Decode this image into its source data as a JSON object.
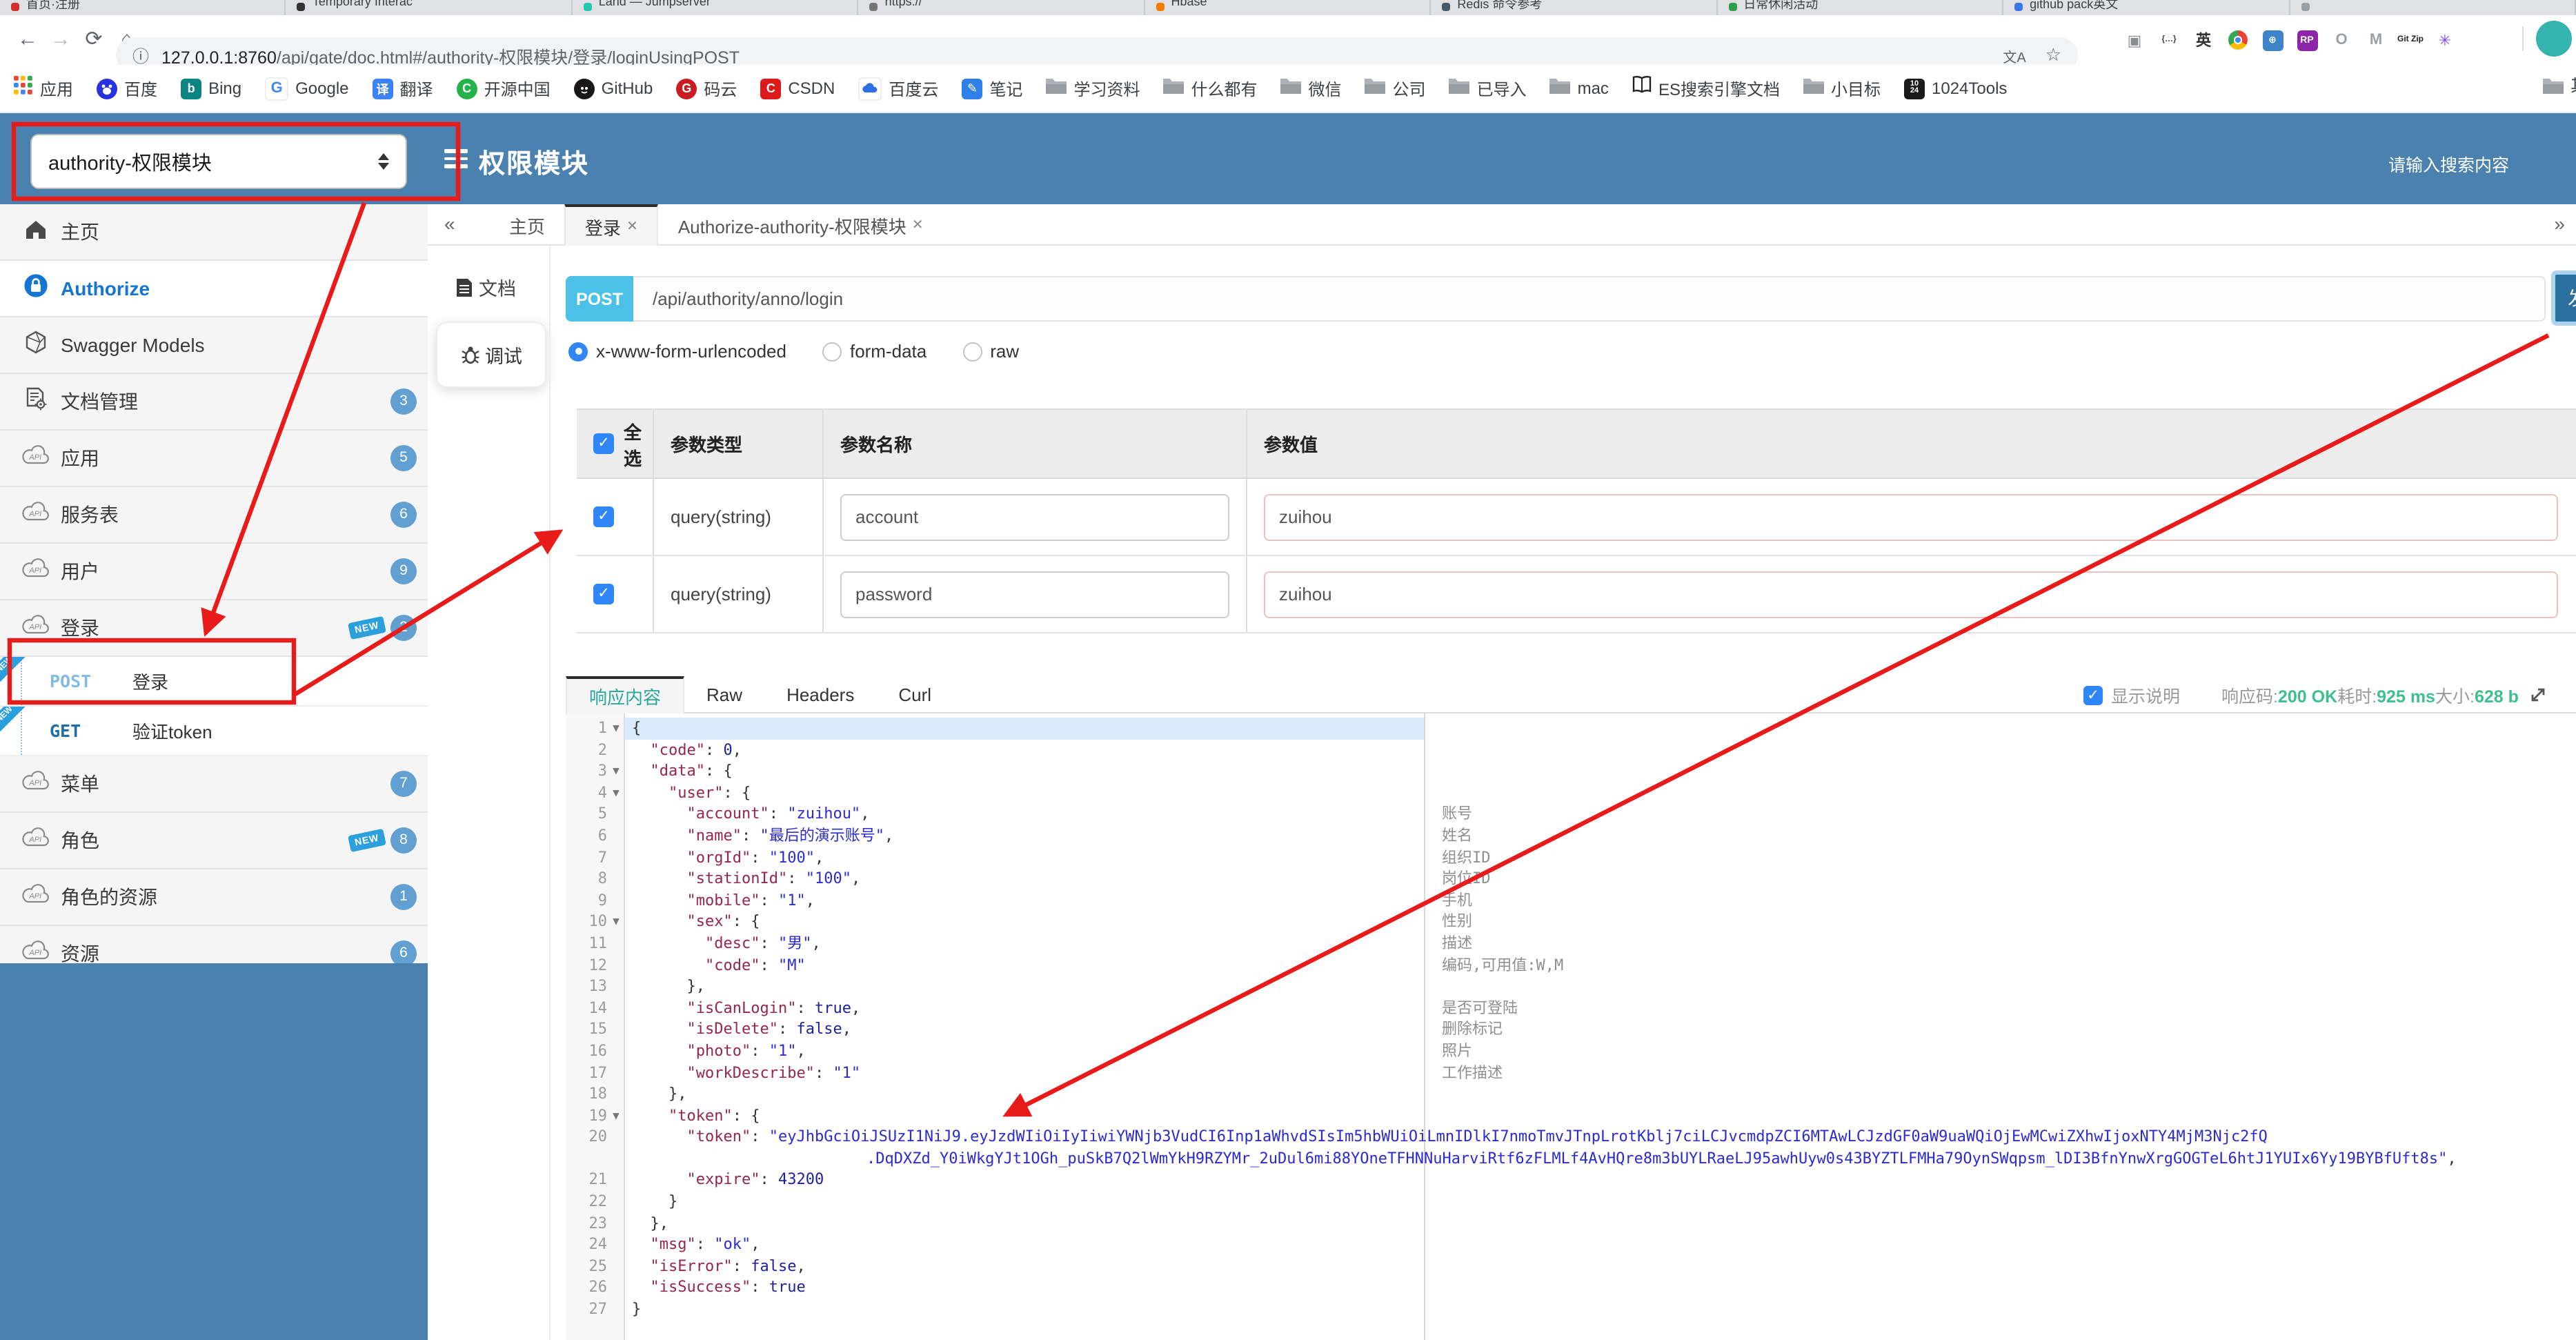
{
  "browser": {
    "tabs": [
      {
        "title": "首页·注册",
        "color": "#d32f2f"
      },
      {
        "title": "Temporary Interac",
        "color": "#333333"
      },
      {
        "title": "Land — Jumpserver",
        "color": "#26c6b0"
      },
      {
        "title": "https://",
        "color": "#757575"
      },
      {
        "title": "Hbase",
        "color": "#f57c00"
      },
      {
        "title": "Redis 命令参考",
        "color": "#455a64"
      },
      {
        "title": "日常休闲活动",
        "color": "#2e9e4f"
      },
      {
        "title": "github pack英文",
        "color": "#3b78e7"
      },
      {
        "title": "",
        "color": "#9aa0a6"
      }
    ],
    "url_host": "127.0.0.1:8760",
    "url_path": "/api/gate/doc.html#/authority-权限模块/登录/loginUsingPOST",
    "extensions": [
      {
        "name": "notes-extension-icon",
        "glyph": "▣",
        "bg": "",
        "fg": "#8a8d91"
      },
      {
        "name": "json-brackets-icon",
        "glyph": "{…}",
        "bg": "",
        "fg": "#444"
      },
      {
        "name": "translate-en-icon",
        "glyph": "英",
        "bg": "",
        "fg": "#333"
      },
      {
        "name": "chrome-icon",
        "glyph": "",
        "bg": "conic",
        "fg": ""
      },
      {
        "name": "globe-icon",
        "glyph": "⊕",
        "bg": "#3d85c8",
        "fg": "#fff"
      },
      {
        "name": "axure-rp-icon",
        "glyph": "RP",
        "bg": "#8e24aa",
        "fg": "#fff"
      },
      {
        "name": "oval-icon",
        "glyph": "O",
        "bg": "",
        "fg": "#9aa0a6"
      },
      {
        "name": "arrow-m-icon",
        "glyph": "M",
        "bg": "",
        "fg": "#9aa0a6"
      },
      {
        "name": "gitzip-icon",
        "glyph": "Git Zip",
        "bg": "",
        "fg": "#222"
      },
      {
        "name": "asterisk-icon",
        "glyph": "✳",
        "bg": "",
        "fg": "#7c4dff"
      }
    ],
    "bookmarks": [
      {
        "label": "应用",
        "icon": "apps"
      },
      {
        "label": "百度",
        "icon": "baidu"
      },
      {
        "label": "Bing",
        "icon": "bing"
      },
      {
        "label": "Google",
        "icon": "google"
      },
      {
        "label": "翻译",
        "icon": "translate"
      },
      {
        "label": "开源中国",
        "icon": "oschina"
      },
      {
        "label": "GitHub",
        "icon": "github"
      },
      {
        "label": "码云",
        "icon": "gitee"
      },
      {
        "label": "CSDN",
        "icon": "csdn"
      },
      {
        "label": "百度云",
        "icon": "baiduyun"
      },
      {
        "label": "笔记",
        "icon": "note"
      },
      {
        "label": "学习资料",
        "icon": "folder"
      },
      {
        "label": "什么都有",
        "icon": "folder"
      },
      {
        "label": "微信",
        "icon": "folder"
      },
      {
        "label": "公司",
        "icon": "folder"
      },
      {
        "label": "已导入",
        "icon": "folder"
      },
      {
        "label": "mac",
        "icon": "folder"
      },
      {
        "label": "ES搜索引擎文档",
        "icon": "book"
      },
      {
        "label": "小目标",
        "icon": "folder"
      },
      {
        "label": "1024Tools",
        "icon": "tools1024"
      }
    ],
    "bookmarks_overflow": {
      "label": "其他书签",
      "icon": "folder"
    }
  },
  "header": {
    "module_select": "authority-权限模块",
    "title": "权限模块",
    "search_placeholder": "请输入搜索内容"
  },
  "sidebar": {
    "items": [
      {
        "kind": "main",
        "icon": "home",
        "label": "主页"
      },
      {
        "kind": "main",
        "icon": "lock",
        "label": "Authorize",
        "auth": true
      },
      {
        "kind": "main",
        "icon": "hex",
        "label": "Swagger Models"
      },
      {
        "kind": "main",
        "icon": "docgear",
        "label": "文档管理",
        "badge": "3"
      },
      {
        "kind": "main",
        "icon": "cloud",
        "label": "应用",
        "badge": "5"
      },
      {
        "kind": "main",
        "icon": "cloud",
        "label": "服务表",
        "badge": "6"
      },
      {
        "kind": "main",
        "icon": "cloud",
        "label": "用户",
        "badge": "9"
      },
      {
        "kind": "main",
        "icon": "cloud",
        "label": "登录",
        "badge": "2",
        "newsign": "NEW"
      },
      {
        "kind": "sub",
        "method": "POST",
        "label": "登录",
        "ribbon": "NEW"
      },
      {
        "kind": "sub",
        "method": "GET",
        "label": "验证token",
        "ribbon": "NEW"
      },
      {
        "kind": "main",
        "icon": "cloud",
        "label": "菜单",
        "badge": "7"
      },
      {
        "kind": "main",
        "icon": "cloud",
        "label": "角色",
        "badge": "8",
        "newsign": "NEW"
      },
      {
        "kind": "main",
        "icon": "cloud",
        "label": "角色的资源",
        "badge": "1"
      },
      {
        "kind": "main",
        "icon": "cloud",
        "label": "资源",
        "badge": "6"
      }
    ]
  },
  "main_tabs": {
    "collapse": "«",
    "expand": "»",
    "tabs": [
      {
        "label": "主页",
        "closable": false,
        "active": false
      },
      {
        "label": "登录",
        "closable": true,
        "active": true
      },
      {
        "label": "Authorize-authority-权限模块",
        "closable": true,
        "active": false
      }
    ]
  },
  "doc_tabs": {
    "doc": "文档",
    "debug": "调试"
  },
  "request": {
    "method": "POST",
    "path": "/api/authority/anno/login",
    "send_label": "发",
    "content_types": [
      {
        "label": "x-www-form-urlencoded",
        "selected": true
      },
      {
        "label": "form-data",
        "selected": false
      },
      {
        "label": "raw",
        "selected": false
      }
    ]
  },
  "params": {
    "headers": {
      "select_all": "全选",
      "type": "参数类型",
      "name": "参数名称",
      "value": "参数值"
    },
    "rows": [
      {
        "checked": true,
        "type": "query(string)",
        "name": "account",
        "value": "zuihou"
      },
      {
        "checked": true,
        "type": "query(string)",
        "name": "password",
        "value": "zuihou"
      }
    ]
  },
  "response": {
    "tabs": [
      {
        "label": "响应内容",
        "active": true
      },
      {
        "label": "Raw",
        "active": false
      },
      {
        "label": "Headers",
        "active": false
      },
      {
        "label": "Curl",
        "active": false
      }
    ],
    "show_note_label": "显示说明",
    "status": [
      {
        "label": "响应码:",
        "value": "200 OK"
      },
      {
        "label": "耗时:",
        "value": "925 ms"
      },
      {
        "label": "大小:",
        "value": "628 b"
      }
    ]
  },
  "code": {
    "lines": [
      {
        "n": 1,
        "fold": true,
        "active": true,
        "parts": [
          [
            "p",
            "{"
          ]
        ]
      },
      {
        "n": 2,
        "parts": [
          [
            "p",
            "  "
          ],
          [
            "k",
            "\"code\""
          ],
          [
            "p",
            ": "
          ],
          [
            "n2",
            "0"
          ],
          [
            "p",
            ","
          ]
        ]
      },
      {
        "n": 3,
        "fold": true,
        "parts": [
          [
            "p",
            "  "
          ],
          [
            "k",
            "\"data\""
          ],
          [
            "p",
            ": {"
          ]
        ]
      },
      {
        "n": 4,
        "fold": true,
        "parts": [
          [
            "p",
            "    "
          ],
          [
            "k",
            "\"user\""
          ],
          [
            "p",
            ": {"
          ]
        ]
      },
      {
        "n": 5,
        "note": "账号",
        "parts": [
          [
            "p",
            "      "
          ],
          [
            "k",
            "\"account\""
          ],
          [
            "p",
            ": "
          ],
          [
            "s",
            "\"zuihou\""
          ],
          [
            "p",
            ","
          ]
        ]
      },
      {
        "n": 6,
        "note": "姓名",
        "parts": [
          [
            "p",
            "      "
          ],
          [
            "k",
            "\"name\""
          ],
          [
            "p",
            ": "
          ],
          [
            "s",
            "\"最后的演示账号\""
          ],
          [
            "p",
            ","
          ]
        ]
      },
      {
        "n": 7,
        "note": "组织ID",
        "parts": [
          [
            "p",
            "      "
          ],
          [
            "k",
            "\"orgId\""
          ],
          [
            "p",
            ": "
          ],
          [
            "s",
            "\"100\""
          ],
          [
            "p",
            ","
          ]
        ]
      },
      {
        "n": 8,
        "note": "岗位ID",
        "parts": [
          [
            "p",
            "      "
          ],
          [
            "k",
            "\"stationId\""
          ],
          [
            "p",
            ": "
          ],
          [
            "s",
            "\"100\""
          ],
          [
            "p",
            ","
          ]
        ]
      },
      {
        "n": 9,
        "note": "手机",
        "parts": [
          [
            "p",
            "      "
          ],
          [
            "k",
            "\"mobile\""
          ],
          [
            "p",
            ": "
          ],
          [
            "s",
            "\"1\""
          ],
          [
            "p",
            ","
          ]
        ]
      },
      {
        "n": 10,
        "fold": true,
        "note": "性别",
        "parts": [
          [
            "p",
            "      "
          ],
          [
            "k",
            "\"sex\""
          ],
          [
            "p",
            ": {"
          ]
        ]
      },
      {
        "n": 11,
        "note": "描述",
        "parts": [
          [
            "p",
            "        "
          ],
          [
            "k",
            "\"desc\""
          ],
          [
            "p",
            ": "
          ],
          [
            "s",
            "\"男\""
          ],
          [
            "p",
            ","
          ]
        ]
      },
      {
        "n": 12,
        "note": "编码,可用值:W,M",
        "parts": [
          [
            "p",
            "        "
          ],
          [
            "k",
            "\"code\""
          ],
          [
            "p",
            ": "
          ],
          [
            "s",
            "\"M\""
          ]
        ]
      },
      {
        "n": 13,
        "parts": [
          [
            "p",
            "      },"
          ]
        ]
      },
      {
        "n": 14,
        "note": "是否可登陆",
        "parts": [
          [
            "p",
            "      "
          ],
          [
            "k",
            "\"isCanLogin\""
          ],
          [
            "p",
            ": "
          ],
          [
            "n2",
            "true"
          ],
          [
            "p",
            ","
          ]
        ]
      },
      {
        "n": 15,
        "note": "删除标记",
        "parts": [
          [
            "p",
            "      "
          ],
          [
            "k",
            "\"isDelete\""
          ],
          [
            "p",
            ": "
          ],
          [
            "n2",
            "false"
          ],
          [
            "p",
            ","
          ]
        ]
      },
      {
        "n": 16,
        "note": "照片",
        "parts": [
          [
            "p",
            "      "
          ],
          [
            "k",
            "\"photo\""
          ],
          [
            "p",
            ": "
          ],
          [
            "s",
            "\"1\""
          ],
          [
            "p",
            ","
          ]
        ]
      },
      {
        "n": 17,
        "note": "工作描述",
        "parts": [
          [
            "p",
            "      "
          ],
          [
            "k",
            "\"workDescribe\""
          ],
          [
            "p",
            ": "
          ],
          [
            "s",
            "\"1\""
          ]
        ]
      },
      {
        "n": 18,
        "parts": [
          [
            "p",
            "    },"
          ]
        ]
      },
      {
        "n": 19,
        "fold": true,
        "parts": [
          [
            "p",
            "    "
          ],
          [
            "k",
            "\"token\""
          ],
          [
            "p",
            ": {"
          ]
        ]
      },
      {
        "n": 20,
        "parts": [
          [
            "p",
            "      "
          ],
          [
            "k",
            "\"token\""
          ],
          [
            "p",
            ": "
          ],
          [
            "s",
            "\"eyJhbGciOiJSUzI1NiJ9.eyJzdWIiOiIyIiwiYWNjb3VudCI6Inp1aWhvdSIsIm5hbWUiOiLmnIDlkI7nmoTmvJTnpLrotKblj7ciLCJvcmdpZCI6MTAwLCJzdGF0aW9uaWQiOjEwMCwiZXhwIjoxNTY4MjM3Njc2fQ"
          ]
        ]
      },
      {
        "n": null,
        "wrap": 170,
        "parts": [
          [
            "s",
            ".DqDXZd_Y0iWkgYJt1OGh_puSkB7Q2lWmYkH9RZYMr_2uDul6mi88YOneTFHNNuHarviRtf6zFLMLf4AvHQre8m3bUYLRaeLJ95awhUyw0s43BYZTLFMHa79OynSWqpsm_lDI3BfnYnwXrgGOGTeL6htJ1YUIx6Yy19BYBfUft8s\""
          ],
          [
            "p",
            ","
          ]
        ]
      },
      {
        "n": 21,
        "parts": [
          [
            "p",
            "      "
          ],
          [
            "k",
            "\"expire\""
          ],
          [
            "p",
            ": "
          ],
          [
            "n2",
            "43200"
          ]
        ]
      },
      {
        "n": 22,
        "parts": [
          [
            "p",
            "    }"
          ]
        ]
      },
      {
        "n": 23,
        "parts": [
          [
            "p",
            "  },"
          ]
        ]
      },
      {
        "n": 24,
        "parts": [
          [
            "p",
            "  "
          ],
          [
            "k",
            "\"msg\""
          ],
          [
            "p",
            ": "
          ],
          [
            "s",
            "\"ok\""
          ],
          [
            "p",
            ","
          ]
        ]
      },
      {
        "n": 25,
        "parts": [
          [
            "p",
            "  "
          ],
          [
            "k",
            "\"isError\""
          ],
          [
            "p",
            ": "
          ],
          [
            "n2",
            "false"
          ],
          [
            "p",
            ","
          ]
        ]
      },
      {
        "n": 26,
        "parts": [
          [
            "p",
            "  "
          ],
          [
            "k",
            "\"isSuccess\""
          ],
          [
            "p",
            ": "
          ],
          [
            "n2",
            "true"
          ]
        ]
      },
      {
        "n": 27,
        "parts": [
          [
            "p",
            "}"
          ]
        ]
      }
    ]
  },
  "colors": {
    "header_blue": "#4a81ae",
    "post_chip": "#4dc0e8",
    "send_button": "#2b6f9e",
    "badge_blue": "#63a0d2",
    "new_blue": "#2ba0dd",
    "status_green": "#3fbf8f",
    "annotation_red": "#e81a1a",
    "active_resp_tab": "#2aa79b"
  }
}
